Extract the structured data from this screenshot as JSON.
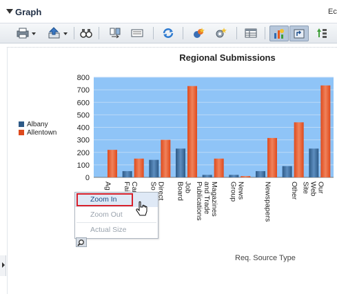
{
  "panel": {
    "title": "Graph",
    "right_text": "Ec"
  },
  "toolbar": {
    "buttons": [
      "print-icon",
      "export-icon",
      "binoculars-icon",
      "swap-icon",
      "legend-icon",
      "refresh-icon",
      "wizard-icon",
      "settings-icon",
      "table-icon",
      "graph-view-icon",
      "pivot-icon",
      "sort-icon"
    ],
    "active": [
      "graph-view-icon",
      "pivot-icon"
    ]
  },
  "legend": {
    "items": [
      {
        "label": "Albany",
        "color": "#2e5a87"
      },
      {
        "label": "Allentown",
        "color": "#de4a1d"
      }
    ]
  },
  "chart_data": {
    "type": "bar",
    "title": "Regional Submissions",
    "xlabel": "Req. Source Type",
    "ylabel": "",
    "ylim": [
      0,
      800
    ],
    "yticks": [
      0,
      100,
      200,
      300,
      400,
      500,
      600,
      700,
      800
    ],
    "categories": [
      [
        "Ag"
      ],
      [
        "Car",
        "Fair"
      ],
      [
        "Direct",
        "So"
      ],
      [
        "Job",
        "Board"
      ],
      [
        "Magazines",
        "and Trade",
        "Publications"
      ],
      [
        "News",
        "Group"
      ],
      [
        "Newspapers"
      ],
      [
        "Other"
      ],
      [
        "Our",
        "Web",
        "Site"
      ]
    ],
    "series": [
      {
        "name": "Albany",
        "color": "#2e5a87",
        "values": [
          0,
          50,
          140,
          230,
          20,
          20,
          50,
          90,
          230
        ]
      },
      {
        "name": "Allentown",
        "color": "#de4a1d",
        "values": [
          220,
          150,
          300,
          730,
          150,
          10,
          315,
          440,
          735
        ]
      }
    ],
    "plot_background": "#8fc4f7",
    "grid": true
  },
  "context_menu": {
    "items": [
      {
        "label": "Zoom In",
        "enabled": true
      },
      {
        "label": "Zoom Out",
        "enabled": false
      },
      {
        "label": "Actual Size",
        "enabled": false
      }
    ]
  }
}
